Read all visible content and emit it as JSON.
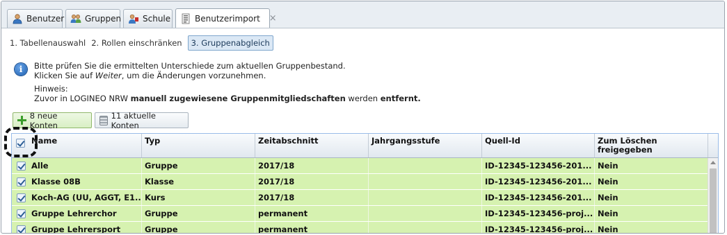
{
  "tabs": [
    {
      "label": "Benutzer",
      "icon": "user-icon"
    },
    {
      "label": "Gruppen",
      "icon": "group-icon"
    },
    {
      "label": "Schule",
      "icon": "school-icon"
    },
    {
      "label": "Benutzerimport",
      "icon": "import-icon",
      "active": true,
      "close": "×"
    }
  ],
  "steps": [
    {
      "label": "1. Tabellenauswahl"
    },
    {
      "label": "2. Rollen einschränken"
    },
    {
      "label": "3. Gruppenabgleich",
      "active": true
    }
  ],
  "info": {
    "icon": "info-icon",
    "icon_glyph": "i",
    "line1": "Bitte prüfen Sie die ermittelten Unterschiede zum aktuellen Gruppenbestand.",
    "line2_pre": "Klicken Sie auf ",
    "line2_em": "Weiter",
    "line2_post": ", um die Änderungen vorzunehmen.",
    "hint_label": "Hinweis:",
    "hint_pre": "Zuvor in LOGINEO NRW ",
    "hint_bold1": "manuell zugewiesene Gruppenmitgliedschaften",
    "hint_mid": " werden ",
    "hint_bold2": "entfernt."
  },
  "filters": {
    "new_accounts": "8 neue Konten",
    "current_accounts": "11 aktuelle Konten"
  },
  "grid": {
    "columns": [
      "Name",
      "Typ",
      "Zeitabschnitt",
      "Jahrgangsstufe",
      "Quell-Id",
      "Zum Löschen freigegeben"
    ],
    "rows": [
      [
        "Alle",
        "Gruppe",
        "2017/18",
        "",
        "ID-12345-123456-201...",
        "Nein"
      ],
      [
        "Klasse 08B",
        "Klasse",
        "2017/18",
        "",
        "ID-12345-123456-201...",
        "Nein"
      ],
      [
        "Koch-AG (UU, AGGT, E1...",
        "Kurs",
        "2017/18",
        "",
        "ID-12345-123456-201...",
        "Nein"
      ],
      [
        "Gruppe Lehrerchor",
        "Gruppe",
        "permanent",
        "",
        "ID-12345-123456-proj...",
        "Nein"
      ],
      [
        "Gruppe Lehrersport",
        "Gruppe",
        "permanent",
        "",
        "ID-12345-123456-proj...",
        "Nein"
      ]
    ]
  },
  "colors": {
    "row_highlight": "#d6f2b0",
    "accent": "#7ea6cc"
  }
}
